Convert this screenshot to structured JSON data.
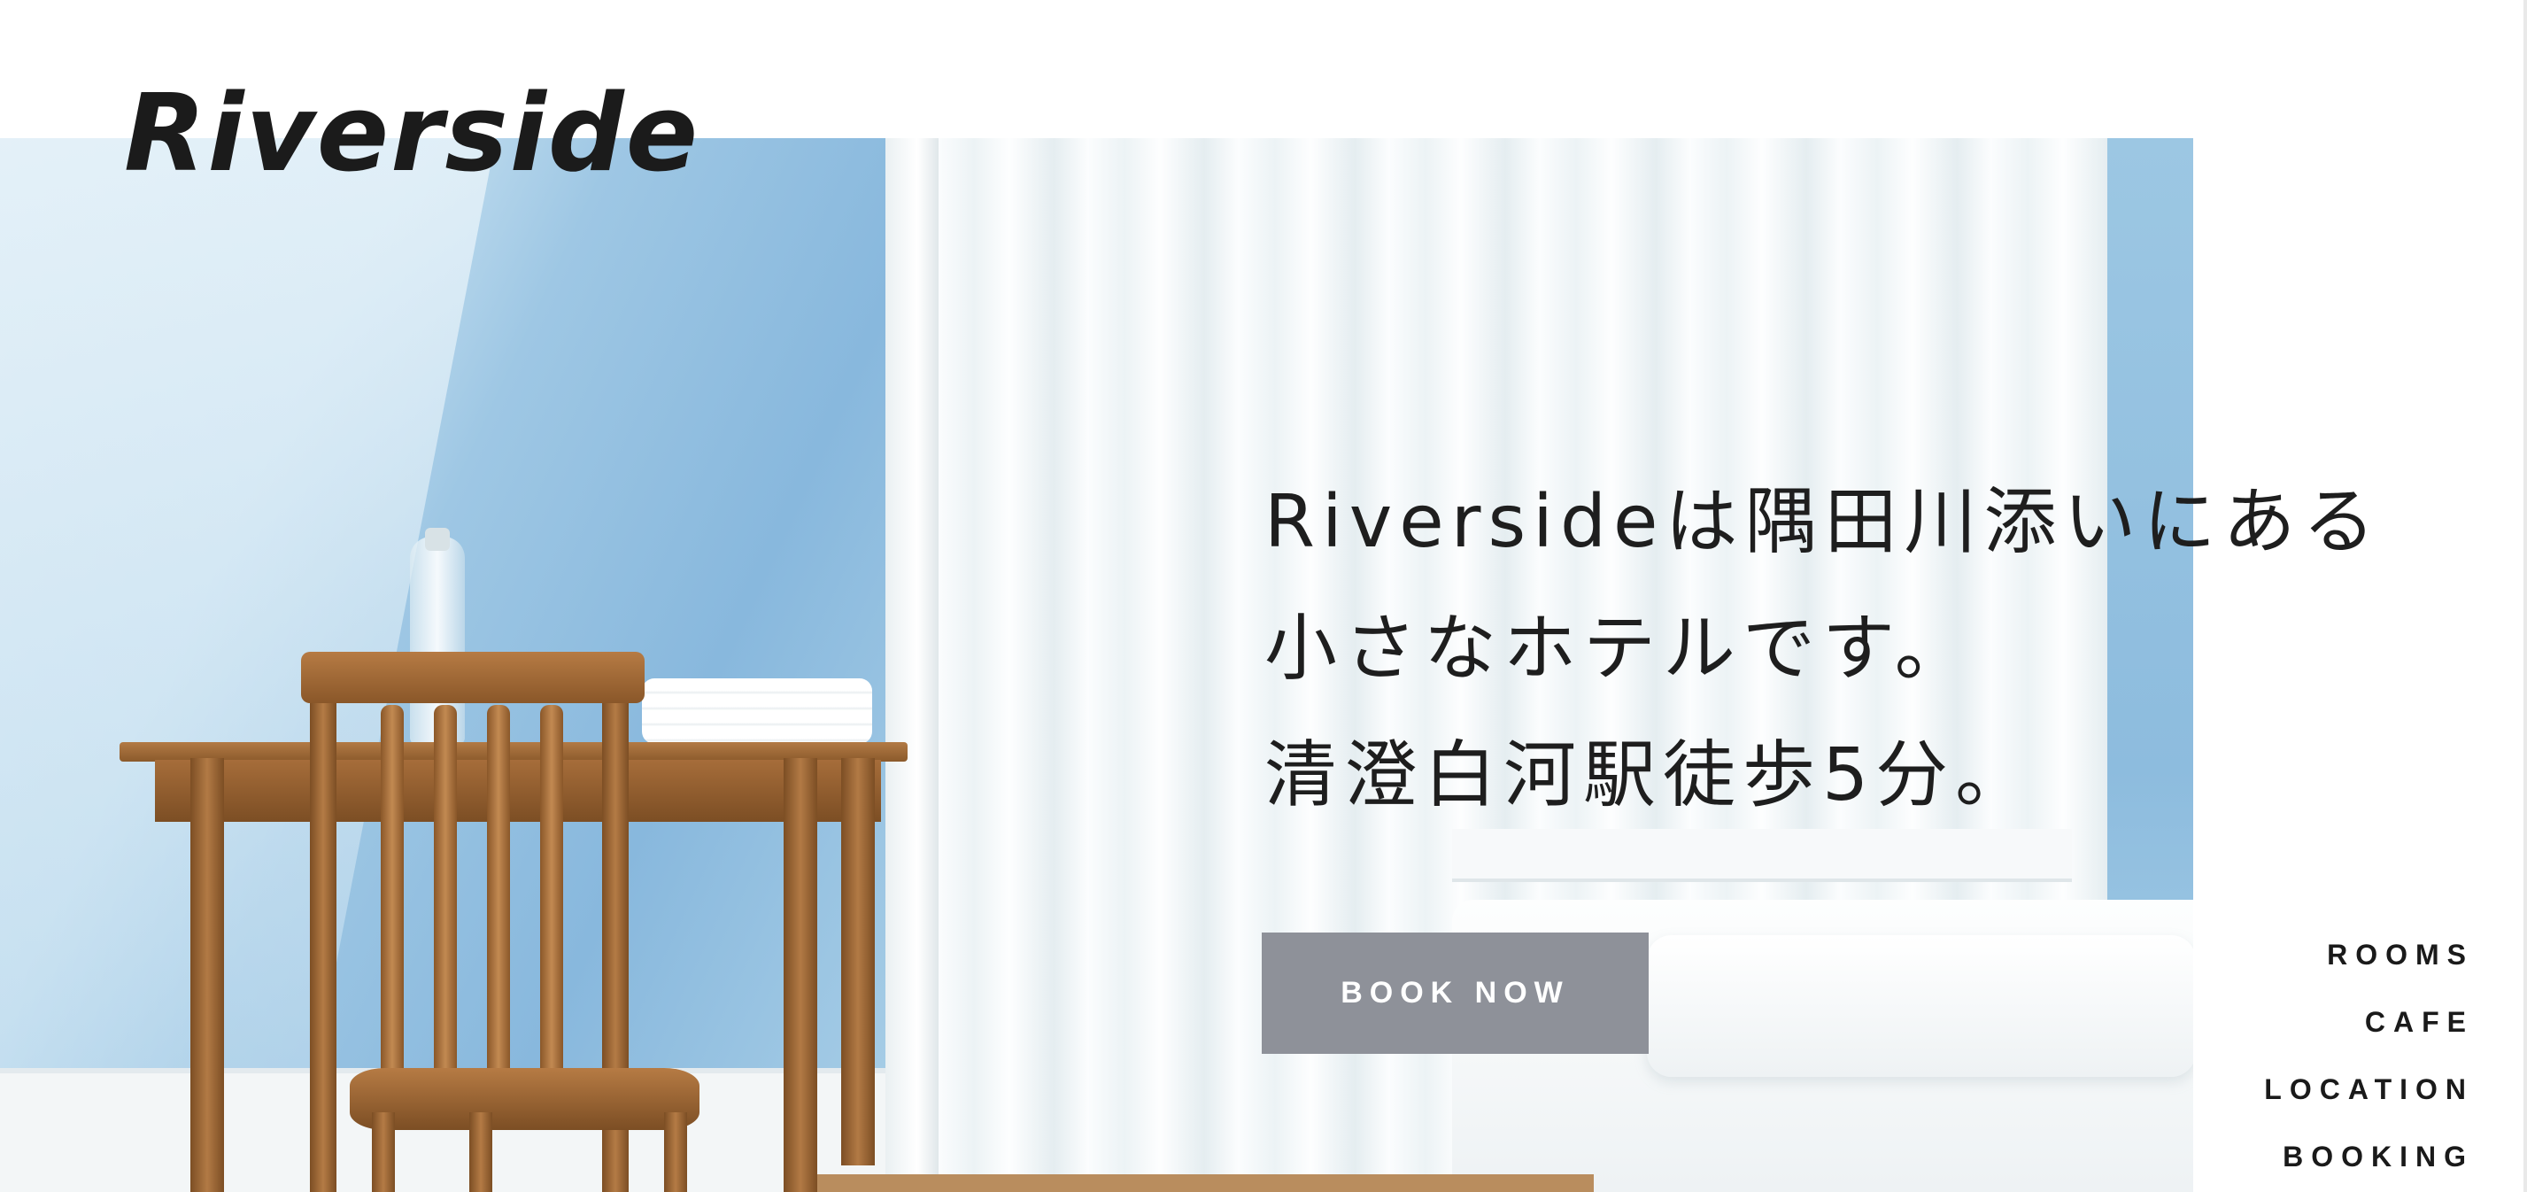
{
  "brand": {
    "logo_text": "Riverside"
  },
  "hero": {
    "image_subject": "hotel-room-photo",
    "headline_lines": [
      "Riversideは隅田川添いにある",
      "小さなホテルです。",
      "清澄白河駅徒歩5分。"
    ],
    "cta_label": "BOOK NOW"
  },
  "nav": {
    "items": [
      {
        "label": "ROOMS"
      },
      {
        "label": "CAFE"
      },
      {
        "label": "LOCATION"
      },
      {
        "label": "BOOKING"
      }
    ]
  },
  "colors": {
    "button": "#8e9199",
    "text": "#1e1e1e",
    "background": "#ffffff"
  }
}
